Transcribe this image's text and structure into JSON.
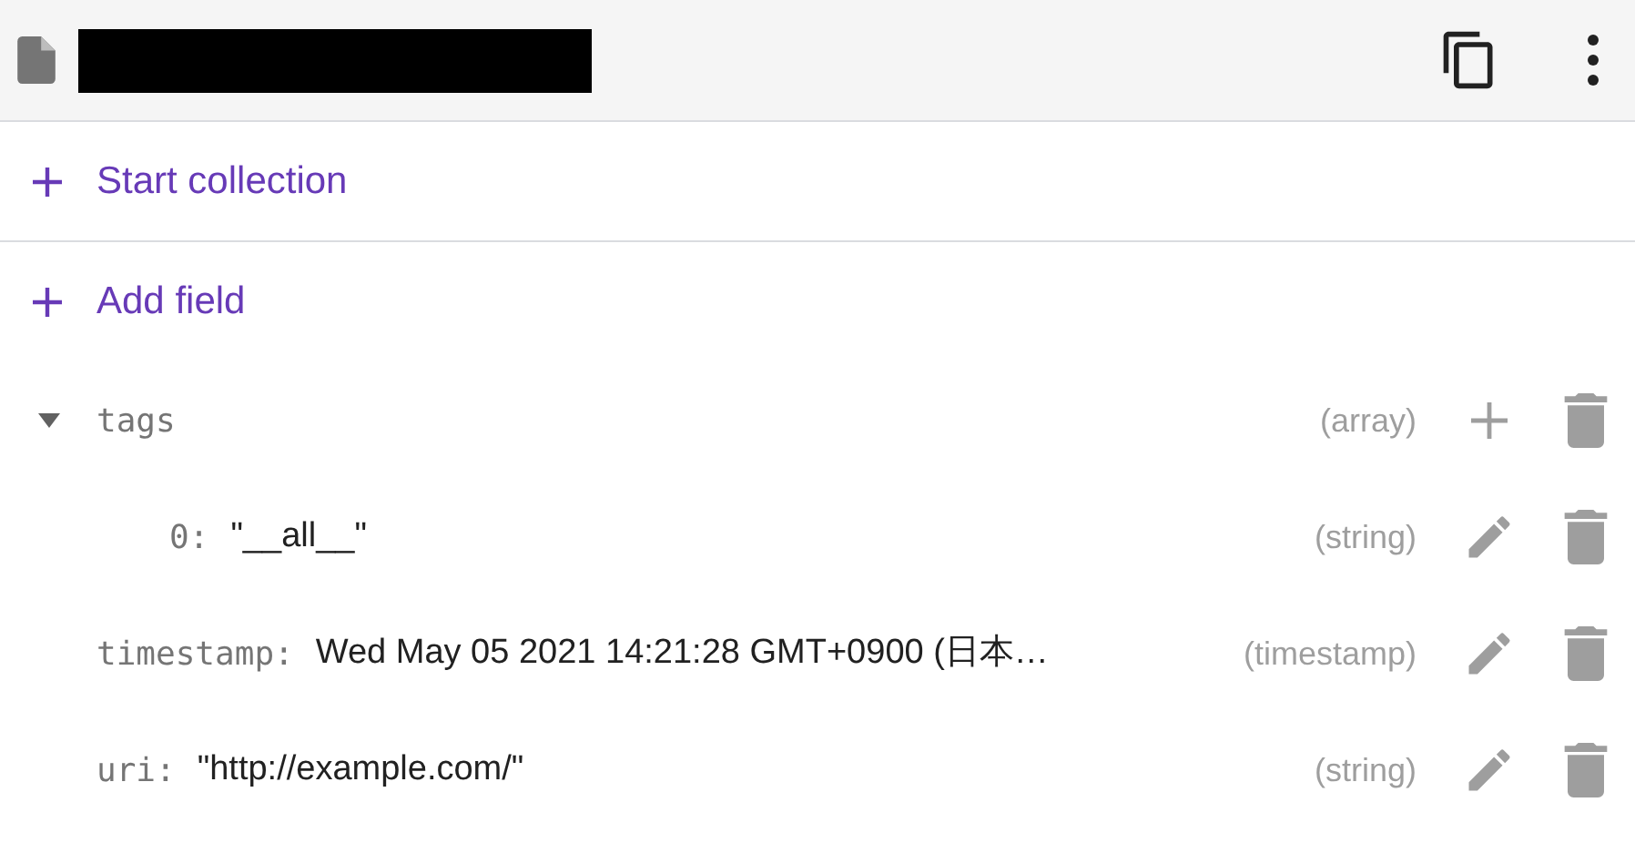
{
  "header": {
    "title_redacted": true
  },
  "start_collection": "Start collection",
  "add_field": "Add field",
  "fields": [
    {
      "kind": "array",
      "key": "tags",
      "type": "(array)",
      "expanded": true,
      "children": [
        {
          "kind": "value",
          "key": "0:",
          "value": "\"__all__\"",
          "type": "(string)"
        }
      ]
    },
    {
      "kind": "value",
      "key": "timestamp:",
      "value": "Wed May 05 2021 14:21:28 GMT+0900 (日本…",
      "type": "(timestamp)"
    },
    {
      "kind": "value",
      "key": "uri:",
      "value": "\"http://example.com/\"",
      "type": "(string)"
    }
  ]
}
